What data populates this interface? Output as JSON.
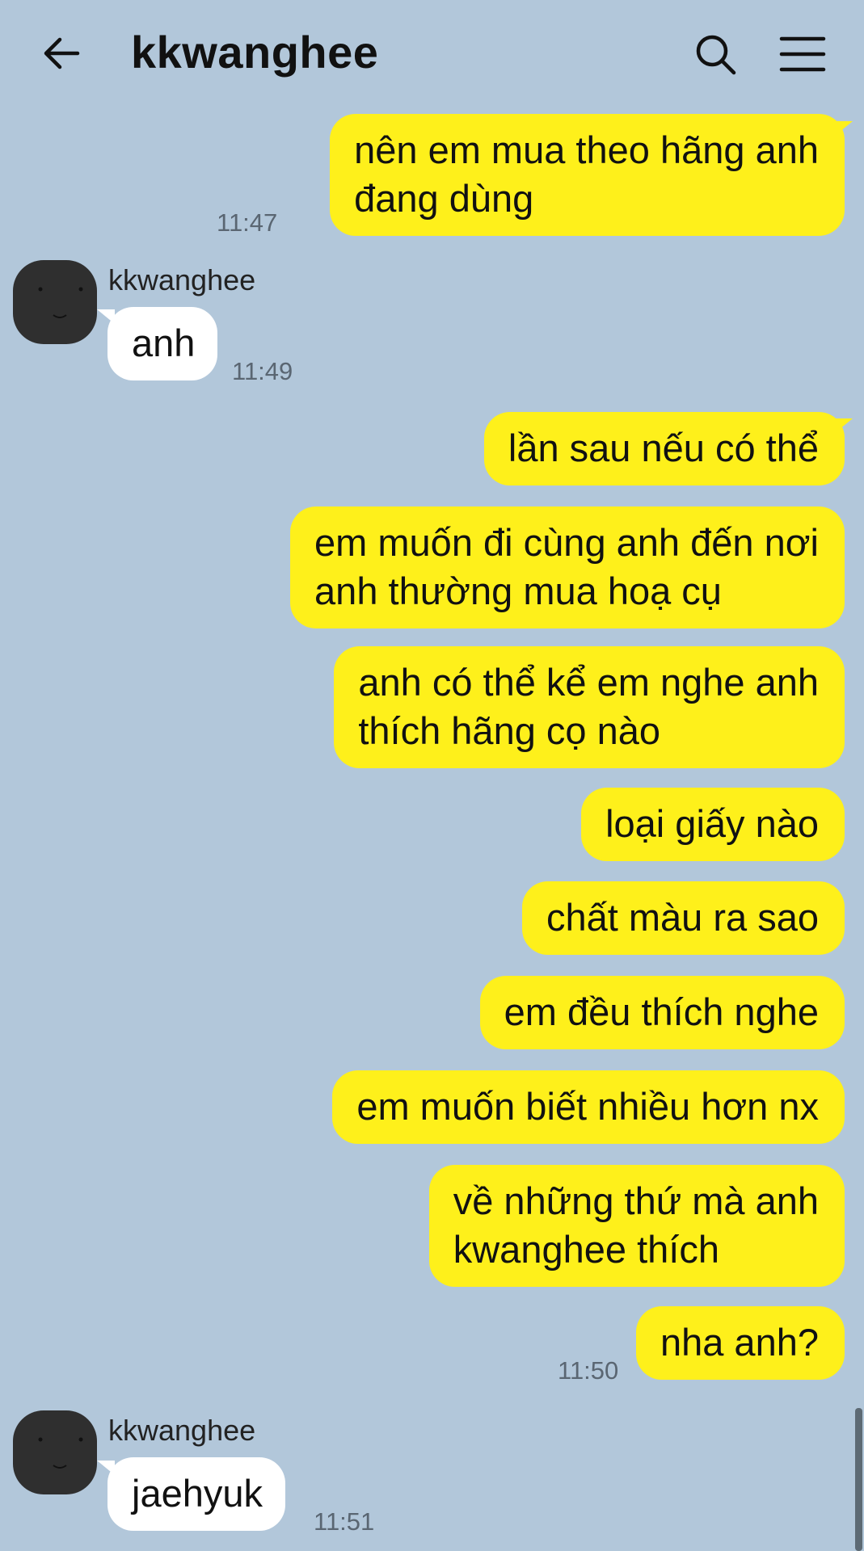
{
  "header": {
    "title": "kkwanghee",
    "back_icon": "arrow-left-icon",
    "search_icon": "search-icon",
    "menu_icon": "hamburger-menu-icon"
  },
  "colors": {
    "background": "#b2c7da",
    "my_bubble": "#fef01b",
    "their_bubble": "#ffffff"
  },
  "messages": [
    {
      "from": "me",
      "lines": [
        "nên em mua theo hãng anh",
        "đang dùng"
      ],
      "time": "11:47"
    },
    {
      "from": "kkwanghee",
      "sender": "kkwanghee",
      "lines": [
        "anh"
      ],
      "time": "11:49"
    },
    {
      "from": "me",
      "lines": [
        "lần sau nếu có thể"
      ]
    },
    {
      "from": "me",
      "lines": [
        "em muốn đi cùng anh đến nơi",
        "anh thường mua hoạ cụ"
      ]
    },
    {
      "from": "me",
      "lines": [
        "anh có thể kể em nghe anh",
        "thích hãng cọ nào"
      ]
    },
    {
      "from": "me",
      "lines": [
        "loại giấy nào"
      ]
    },
    {
      "from": "me",
      "lines": [
        "chất màu ra sao"
      ]
    },
    {
      "from": "me",
      "lines": [
        "em đều thích nghe"
      ]
    },
    {
      "from": "me",
      "lines": [
        "em muốn biết nhiều hơn nx"
      ]
    },
    {
      "from": "me",
      "lines": [
        "về những thứ mà anh",
        "kwanghee thích"
      ]
    },
    {
      "from": "me",
      "lines": [
        "nha anh?"
      ],
      "time": "11:50"
    },
    {
      "from": "kkwanghee",
      "sender": "kkwanghee",
      "lines": [
        "jaehyuk"
      ],
      "time": "11:51"
    }
  ]
}
